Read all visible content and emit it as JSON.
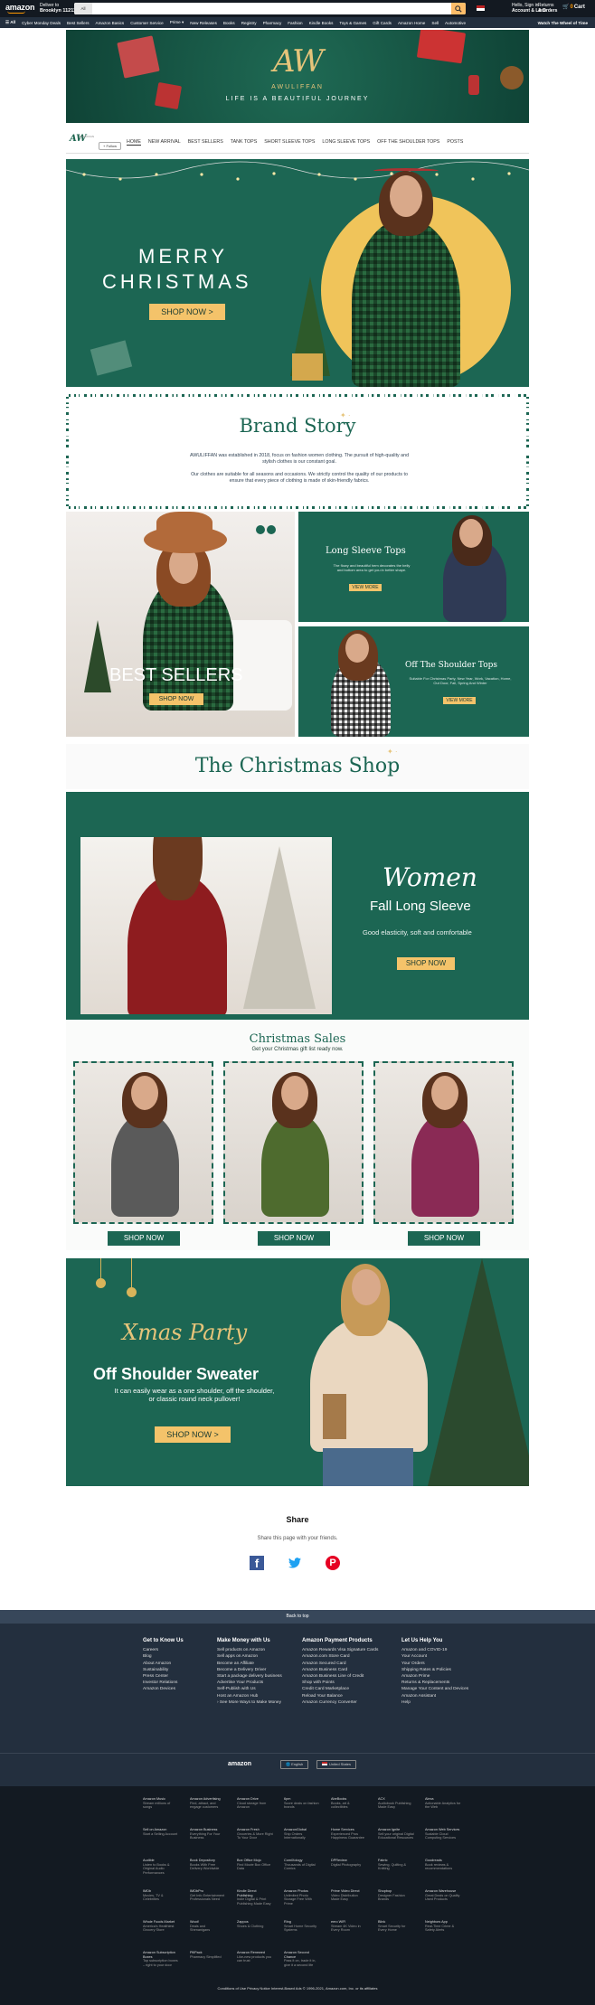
{
  "nav": {
    "logo": "amazon",
    "deliver_line1": "Deliver to",
    "deliver_line2": "Brooklyn 11211",
    "search_category": "All",
    "account_line1": "Hello, Sign in",
    "account_line2": "Account & Lists",
    "orders_line1": "Returns",
    "orders_line2": "& Orders",
    "cart": "Cart",
    "cart_count": "0"
  },
  "subnav": {
    "items": [
      "☰ All",
      "Cyber Monday Deals",
      "Best Sellers",
      "Amazon Basics",
      "Customer Service",
      "Prime ▾",
      "New Releases",
      "Books",
      "Registry",
      "Pharmacy",
      "Fashion",
      "Kindle Books",
      "Toys & Games",
      "Gift Cards",
      "Amazon Home",
      "Sell",
      "Automotive"
    ],
    "right": "Watch The Wheel of Time"
  },
  "store_header": {
    "monogram": "AW",
    "brand": "AWULIFFAN",
    "tagline": "LIFE IS A BEAUTIFUL JOURNEY"
  },
  "store_nav": {
    "mini_logo": "AW",
    "mini_brand": "AWULIFFAN",
    "follow": "+ Follow",
    "items": [
      "HOME",
      "NEW ARRIVAL",
      "BEST SELLERS",
      "TANK TOPS",
      "SHORT SLEEVE TOPS",
      "LONG SLEEVE TOPS",
      "OFF THE SHOULDER TOPS",
      "POSTS"
    ]
  },
  "hero": {
    "line1": "MERRY",
    "line2": "CHRISTMAS",
    "button": "SHOP NOW >"
  },
  "brand_story": {
    "title": "Brand Story",
    "p1": "AWULIFFAN was established in 2018, focus on fashion women clothing. The pursuit of high-quality and stylish clothes is our constant goal.",
    "p2": "Our clothes are suitable for all seasons and occasions. We strictly control the quality of our products to ensure that every piece of clothing is made of skin-friendly fabrics."
  },
  "tiles": {
    "best_sellers": "BEST SELLERS",
    "best_sellers_btn": "SHOP NOW",
    "long_title": "Long Sleeve Tops",
    "long_text": "The flowy and beautiful hem decorates the belly and bottom area to get you in better shape.",
    "long_btn": "VIEW MORE",
    "off_title": "Off The Shoulder Tops",
    "off_text": "Suitable For Christmas Party, New Year, Work, Vacation, Home, Out Door, Fall, Spring And Winter",
    "off_btn": "VIEW MORE"
  },
  "christmas_shop": {
    "title": "The Christmas Shop",
    "women": "Women",
    "fall": "Fall Long Sleeve",
    "desc": "Good elasticity, soft and comfortable",
    "button": "SHOP NOW"
  },
  "sales": {
    "title": "Christmas Sales",
    "subtitle": "Get your Christmas gift list ready now.",
    "cards": [
      {
        "button": "SHOP NOW",
        "color": "#5a5a5a"
      },
      {
        "button": "SHOP NOW",
        "color": "#4e6b2e"
      },
      {
        "button": "SHOP NOW",
        "color": "#8a2a55"
      }
    ]
  },
  "party": {
    "script": "Xmas Party",
    "title": "Off Shoulder Sweater",
    "desc": "It can easily wear as a one shoulder, off the shoulder, or classic round neck pullover!",
    "button": "SHOP NOW >"
  },
  "share": {
    "title": "Share",
    "subtitle": "Share this page with your friends."
  },
  "footer": {
    "back_to_top": "Back to top",
    "columns": [
      {
        "title": "Get to Know Us",
        "links": [
          "Careers",
          "Blog",
          "About Amazon",
          "Sustainability",
          "Press Center",
          "Investor Relations",
          "Amazon Devices"
        ]
      },
      {
        "title": "Make Money with Us",
        "links": [
          "Sell products on Amazon",
          "Sell apps on Amazon",
          "Become an Affiliate",
          "Become a Delivery Driver",
          "Start a package delivery business",
          "Advertise Your Products",
          "Self-Publish with Us",
          "Host an Amazon Hub",
          "› See More Ways to Make Money"
        ]
      },
      {
        "title": "Amazon Payment Products",
        "links": [
          "Amazon Rewards Visa Signature Cards",
          "Amazon.com Store Card",
          "Amazon Secured Card",
          "Amazon Business Card",
          "Amazon Business Line of Credit",
          "Shop with Points",
          "Credit Card Marketplace",
          "Reload Your Balance",
          "Amazon Currency Converter"
        ]
      },
      {
        "title": "Let Us Help You",
        "links": [
          "Amazon and COVID-19",
          "Your Account",
          "Your Orders",
          "Shipping Rates & Policies",
          "Amazon Prime",
          "Returns & Replacements",
          "Manage Your Content and Devices",
          "Amazon Assistant",
          "Help"
        ]
      }
    ],
    "logo": "amazon",
    "language": "🌐 English",
    "country": "United States",
    "services": [
      [
        "Amazon Music",
        "Stream millions of songs"
      ],
      [
        "Amazon Advertising",
        "Find, attract, and engage customers"
      ],
      [
        "Amazon Drive",
        "Cloud storage from Amazon"
      ],
      [
        "6pm",
        "Score deals on fashion brands"
      ],
      [
        "AbeBooks",
        "Books, art & collectibles"
      ],
      [
        "ACX",
        "Audiobook Publishing Made Easy"
      ],
      [
        "Alexa",
        "Actionable Analytics for the Web"
      ],
      [
        "Sell on Amazon",
        "Start a Selling Account"
      ],
      [
        "Amazon Business",
        "Everything For Your Business"
      ],
      [
        "Amazon Fresh",
        "Groceries & More Right To Your Door"
      ],
      [
        "AmazonGlobal",
        "Ship Orders Internationally"
      ],
      [
        "Home Services",
        "Experienced Pros Happiness Guarantee"
      ],
      [
        "Amazon Ignite",
        "Sell your original Digital Educational Resources"
      ],
      [
        "Amazon Web Services",
        "Scalable Cloud Computing Services"
      ],
      [
        "Audible",
        "Listen to Books & Original Audio Performances"
      ],
      [
        "Book Depository",
        "Books With Free Delivery Worldwide"
      ],
      [
        "Box Office Mojo",
        "Find Movie Box Office Data"
      ],
      [
        "ComiXology",
        "Thousands of Digital Comics"
      ],
      [
        "DPReview",
        "Digital Photography"
      ],
      [
        "Fabric",
        "Sewing, Quilting & Knitting"
      ],
      [
        "Goodreads",
        "Book reviews & recommendations"
      ],
      [
        "IMDb",
        "Movies, TV & Celebrities"
      ],
      [
        "IMDbPro",
        "Get Info Entertainment Professionals Need"
      ],
      [
        "Kindle Direct Publishing",
        "Indie Digital & Print Publishing Made Easy"
      ],
      [
        "Amazon Photos",
        "Unlimited Photo Storage Free With Prime"
      ],
      [
        "Prime Video Direct",
        "Video Distribution Made Easy"
      ],
      [
        "Shopbop",
        "Designer Fashion Brands"
      ],
      [
        "Amazon Warehouse",
        "Great Deals on Quality Used Products"
      ],
      [
        "Whole Foods Market",
        "America's Healthiest Grocery Store"
      ],
      [
        "Woot!",
        "Deals and Shenanigans"
      ],
      [
        "Zappos",
        "Shoes & Clothing"
      ],
      [
        "Ring",
        "Smart Home Security Systems"
      ],
      [
        "eero WiFi",
        "Stream 4K Video in Every Room"
      ],
      [
        "Blink",
        "Smart Security for Every Home"
      ],
      [
        "Neighbors App",
        "Real-Time Crime & Safety Alerts"
      ],
      [
        "Amazon Subscription Boxes",
        "Top subscription boxes – right to your door"
      ],
      [
        "PillPack",
        "Pharmacy Simplified"
      ],
      [
        "Amazon Renewed",
        "Like-new products you can trust"
      ],
      [
        "Amazon Second Chance",
        "Pass it on, trade it in, give it a second life"
      ]
    ],
    "legal": "Conditions of Use    Privacy Notice    Interest-Based Ads    © 1996-2021, Amazon.com, Inc. or its affiliates"
  },
  "colors": {
    "brand_green": "#1c6653",
    "gold": "#f4c36a",
    "nav_dark": "#131921"
  }
}
